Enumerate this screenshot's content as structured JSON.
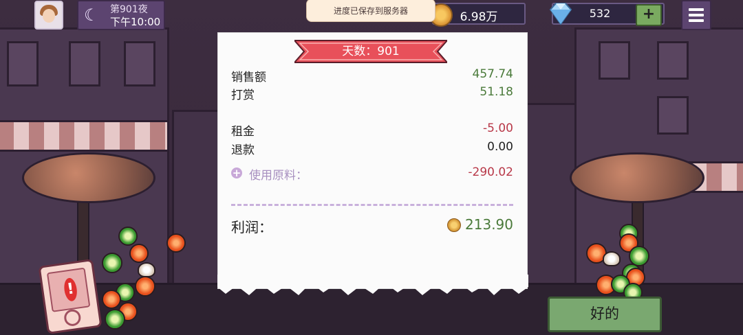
{
  "hud": {
    "night_label": "第901夜",
    "clock": "下午10:00",
    "toast": "进度已保存到服务器",
    "coins": "6.98万",
    "gems": "532",
    "add_gems_label": "+"
  },
  "receipt": {
    "banner": "天数：901",
    "sales_label": "销售额",
    "sales_value": "457.74",
    "tips_label": "打赏",
    "tips_value": "51.18",
    "rent_label": "租金",
    "rent_value": "-5.00",
    "refund_label": "退款",
    "refund_value": "0.00",
    "ingredients_label": "使用原料：",
    "ingredients_value": "-290.02",
    "profit_label": "利润：",
    "profit_value": "213.90"
  },
  "ok_button": "好的",
  "colors": {
    "banner_red": "#e8505a",
    "positive_green": "#4a7a3a",
    "negative_red": "#b83848",
    "ok_green": "#7aa870"
  }
}
